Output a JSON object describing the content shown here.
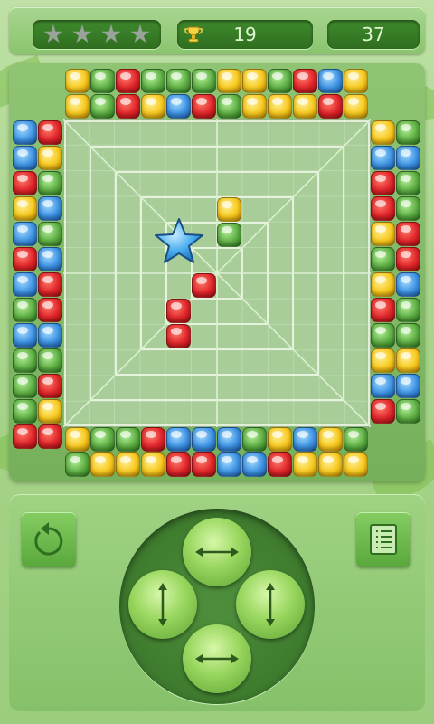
{
  "hud": {
    "stars_total": 4,
    "stars_earned": 0,
    "score": "19",
    "moves": "37",
    "icons": [
      "star-icon",
      "trophy-icon"
    ]
  },
  "colors": {
    "red": "#e0252a",
    "yellow": "#f7c81d",
    "green": "#5dae43",
    "blue": "#3d92e3",
    "board": "#a9cd98",
    "panel": "#8ac46d"
  },
  "board": {
    "top_rows": [
      [
        "y",
        "g",
        "r",
        "g",
        "g",
        "g",
        "y",
        "y",
        "g",
        "r",
        "b",
        "y"
      ],
      [
        "y",
        "g",
        "r",
        "y",
        "b",
        "r",
        "g",
        "y",
        "y",
        "y",
        "r",
        "y"
      ]
    ],
    "bottom_rows": [
      [
        "y",
        "g",
        "g",
        "r",
        "b",
        "b",
        "b",
        "g",
        "y",
        "b",
        "y",
        "g"
      ],
      [
        "g",
        "y",
        "y",
        "y",
        "r",
        "r",
        "b",
        "b",
        "r",
        "y",
        "y",
        "y"
      ]
    ],
    "left_cols": [
      [
        "b",
        "b",
        "r",
        "y",
        "b",
        "r",
        "b",
        "g",
        "b",
        "g",
        "g",
        "g",
        "r"
      ],
      [
        "r",
        "y",
        "g",
        "b",
        "g",
        "b",
        "r",
        "r",
        "b",
        "g",
        "r",
        "y",
        "r"
      ]
    ],
    "right_cols": [
      [
        "y",
        "b",
        "r",
        "r",
        "y",
        "g",
        "y",
        "r",
        "g",
        "y",
        "b",
        "r"
      ],
      [
        "g",
        "b",
        "g",
        "g",
        "r",
        "r",
        "b",
        "g",
        "g",
        "y",
        "b",
        "g"
      ]
    ],
    "inner_pieces": [
      {
        "color": "y",
        "row": 3,
        "col": 6
      },
      {
        "color": "g",
        "row": 4,
        "col": 6
      },
      {
        "color": "r",
        "row": 6,
        "col": 5
      },
      {
        "color": "r",
        "row": 7,
        "col": 4
      },
      {
        "color": "r",
        "row": 8,
        "col": 4
      }
    ],
    "star_piece": {
      "row": 4,
      "col": 4,
      "color": "blue"
    }
  },
  "controls": {
    "undo": "undo-icon",
    "menu": "level-list-icon",
    "dpad": [
      "horizontal-arrows-icon",
      "vertical-arrows-icon",
      "vertical-arrows-icon",
      "horizontal-arrows-icon"
    ]
  }
}
